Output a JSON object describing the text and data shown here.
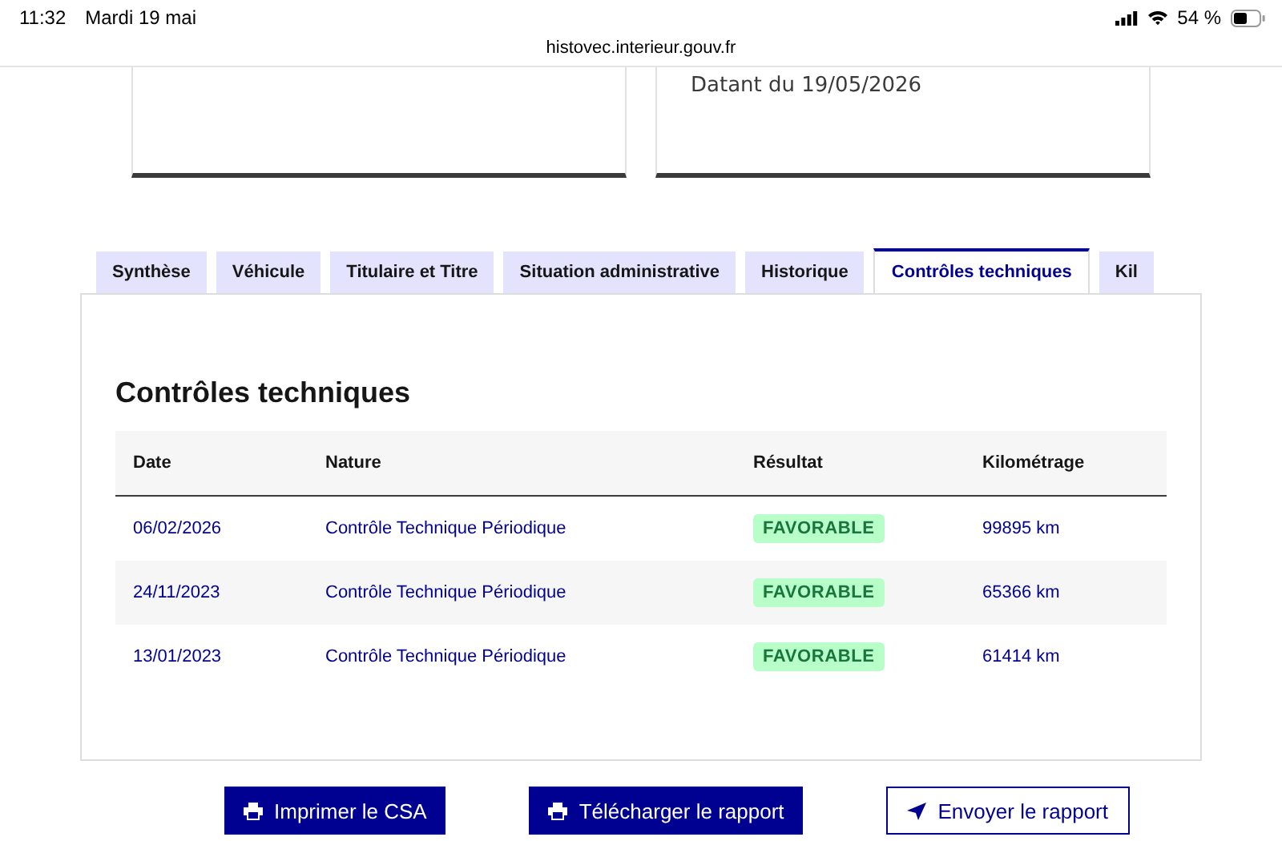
{
  "status_bar": {
    "time": "11:32",
    "date": "Mardi 19 mai",
    "battery": "54 %"
  },
  "address_bar": {
    "url": "histovec.interieur.gouv.fr"
  },
  "cards": [
    {
      "kind": "blank"
    },
    {
      "kind": "text",
      "text": "Datant du 19/05/2026"
    }
  ],
  "tabs": [
    {
      "label": "Synthèse",
      "selected": false
    },
    {
      "label": "Véhicule",
      "selected": false
    },
    {
      "label": "Titulaire et Titre",
      "selected": false
    },
    {
      "label": "Situation administrative",
      "selected": false
    },
    {
      "label": "Historique",
      "selected": false
    },
    {
      "label": "Contrôles techniques",
      "selected": true
    },
    {
      "label": "Kil",
      "selected": false
    }
  ],
  "section": {
    "title": "Contrôles techniques"
  },
  "table": {
    "columns": [
      "Date",
      "Nature",
      "Résultat",
      "Kilométrage"
    ],
    "rows": [
      {
        "date": "06/02/2026",
        "nature": "Contrôle Technique Périodique",
        "result": "FAVORABLE",
        "km": "99895 km"
      },
      {
        "date": "24/11/2023",
        "nature": "Contrôle Technique Périodique",
        "result": "FAVORABLE",
        "km": "65366 km"
      },
      {
        "date": "13/01/2023",
        "nature": "Contrôle Technique Périodique",
        "result": "FAVORABLE",
        "km": "61414 km"
      }
    ]
  },
  "buttons": [
    {
      "label": "Imprimer le CSA",
      "kind": "print",
      "primary": true
    },
    {
      "label": "Télécharger le rapport",
      "kind": "print",
      "primary": true
    },
    {
      "label": "Envoyer le rapport",
      "kind": "send",
      "primary": false
    }
  ]
}
